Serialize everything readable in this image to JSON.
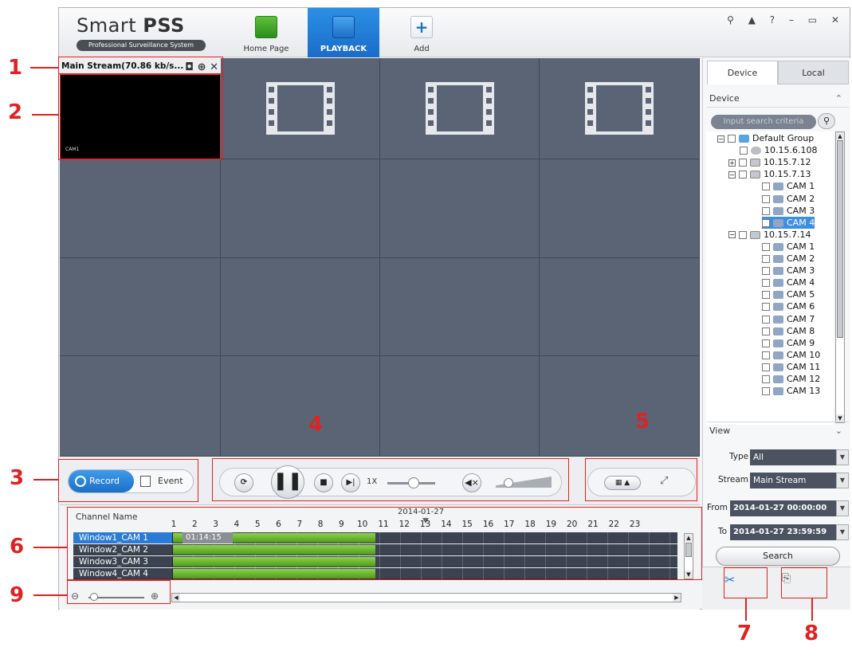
{
  "logo": {
    "title_a": "Smart",
    "title_b": "PSS",
    "subtitle": "Professional Surveillance System"
  },
  "nav": [
    {
      "label": "Home Page",
      "icon": "home-icon"
    },
    {
      "label": "PLAYBACK",
      "icon": "playback-icon"
    },
    {
      "label": "Add",
      "icon": "plus-icon"
    }
  ],
  "window_controls": "⚲ ▲ ? – ▭ ✕",
  "video": {
    "stream_label": "Main Stream(70.86 kb/s...",
    "cam_label": "CAM1",
    "icons": "◘ ⊕ ✕"
  },
  "mode": {
    "record": "Record",
    "event": "Event"
  },
  "playback": {
    "speed": "1X",
    "sync": "⟳",
    "pause": "❚❚",
    "stop": "■",
    "next": "▶|",
    "mute": "◀×"
  },
  "split": {
    "layout": "▦ ▲",
    "full": "⤢"
  },
  "timeline": {
    "channel_header": "Channel Name",
    "date": "2014-01-27",
    "time_tag": "01:14:15",
    "hours": [
      "1",
      "2",
      "3",
      "4",
      "5",
      "6",
      "7",
      "8",
      "9",
      "10",
      "11",
      "12",
      "13",
      "14",
      "15",
      "16",
      "17",
      "18",
      "19",
      "20",
      "21",
      "22",
      "23"
    ],
    "channels": [
      "Window1_CAM 1",
      "Window2_CAM 2",
      "Window3_CAM 3",
      "Window4_CAM 4"
    ],
    "recorded_until_hour": 10
  },
  "panel": {
    "tab_device": "Device",
    "tab_local": "Local",
    "device_header": "Device",
    "search_placeholder": "Input search criteria",
    "view_header": "View",
    "tree": {
      "group": "Default Group",
      "dev1": "10.15.6.108",
      "dev2": "10.15.7.12",
      "dev3": "10.15.7.13",
      "dev3_cams": [
        "CAM 1",
        "CAM 2",
        "CAM 3",
        "CAM 4"
      ],
      "dev4": "10.15.7.14",
      "dev4_cams": [
        "CAM 1",
        "CAM 2",
        "CAM 3",
        "CAM 4",
        "CAM 5",
        "CAM 6",
        "CAM 7",
        "CAM 8",
        "CAM 9",
        "CAM 10",
        "CAM 11",
        "CAM 12",
        "CAM 13"
      ]
    },
    "type_label": "Type",
    "type_value": "All",
    "stream_label": "Stream",
    "stream_value": "Main Stream",
    "from_label": "From",
    "from_value": "2014-01-27 00:00:00",
    "to_label": "To",
    "to_value": "2014-01-27 23:59:59",
    "search_button": "Search"
  },
  "tools": {
    "clip": "✂",
    "download": "⎘"
  },
  "annotations": [
    "1",
    "2",
    "3",
    "4",
    "5",
    "6",
    "7",
    "8",
    "9"
  ]
}
